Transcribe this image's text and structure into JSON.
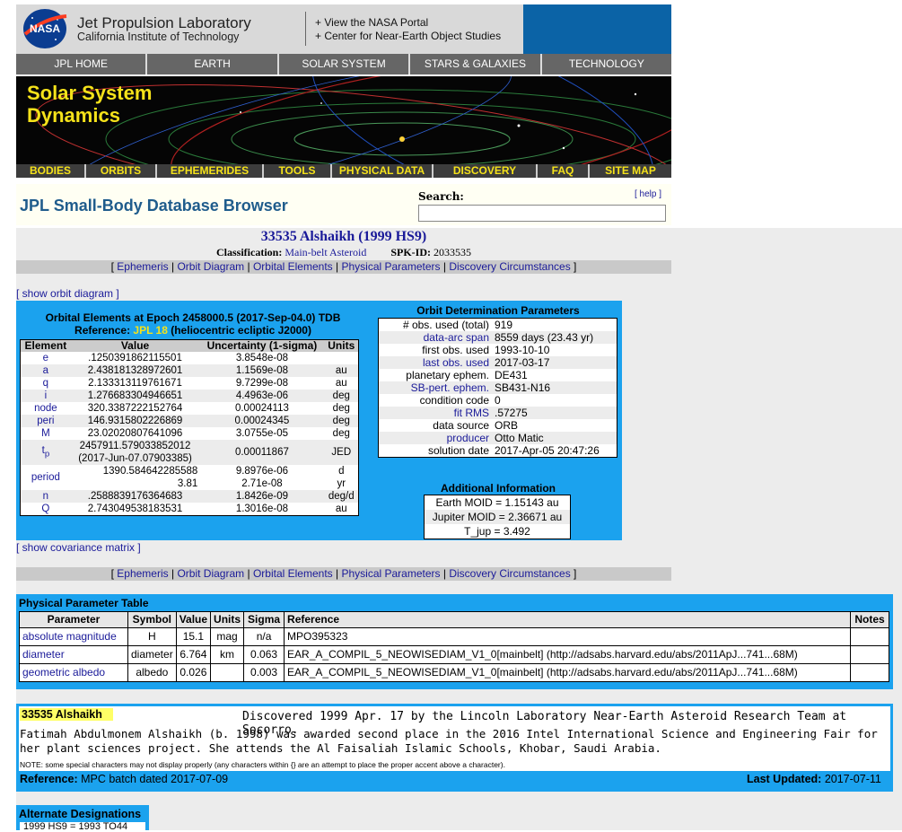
{
  "header": {
    "logo_text": "NASA",
    "title": "Jet Propulsion Laboratory",
    "subtitle": "California Institute of Technology",
    "portal_link": "+ View the NASA Portal",
    "neo_link": "+ Center for Near-Earth Object Studies"
  },
  "topnav": [
    "JPL HOME",
    "EARTH",
    "SOLAR SYSTEM",
    "STARS & GALAXIES",
    "TECHNOLOGY"
  ],
  "banner": {
    "line1": "Solar System",
    "line2": "Dynamics"
  },
  "subnav": [
    "BODIES",
    "ORBITS",
    "EPHEMERIDES",
    "TOOLS",
    "PHYSICAL DATA",
    "DISCOVERY",
    "FAQ",
    "SITE MAP"
  ],
  "page_title": "JPL Small-Body Database Browser",
  "search": {
    "label": "Search:",
    "help": "[ help ]",
    "value": ""
  },
  "object": {
    "title": "33535 Alshaikh (1999 HS9)",
    "class_label": "Classification:",
    "class_value": "Main-belt Asteroid",
    "spk_label": "SPK-ID:",
    "spk_value": "2033535"
  },
  "linkbar": [
    "Ephemeris",
    "Orbit Diagram",
    "Orbital Elements",
    "Physical Parameters",
    "Discovery Circumstances"
  ],
  "show_orbit": "[ show orbit diagram ]",
  "show_cov": "[ show covariance matrix ]",
  "orbital_elements": {
    "title": "Orbital Elements at Epoch 2458000.5 (2017-Sep-04.0) TDB",
    "ref_prefix": "Reference:",
    "ref_value": "JPL 18",
    "ref_suffix": "(heliocentric ecliptic J2000)",
    "headers": [
      "Element",
      "Value",
      "Uncertainty (1-sigma)",
      "Units"
    ],
    "rows": [
      {
        "el": "e",
        "val": ".1250391862115501",
        "unc": "3.8548e-08",
        "units": ""
      },
      {
        "el": "a",
        "val": "2.438181328972601",
        "unc": "1.1569e-08",
        "units": "au"
      },
      {
        "el": "q",
        "val": "2.133313119761671",
        "unc": "9.7299e-08",
        "units": "au"
      },
      {
        "el": "i",
        "val": "1.276683304946651",
        "unc": "4.4963e-06",
        "units": "deg"
      },
      {
        "el": "node",
        "val": "320.3387222152764",
        "unc": "0.00024113",
        "units": "deg"
      },
      {
        "el": "peri",
        "val": "146.9315802226869",
        "unc": "0.00024345",
        "units": "deg"
      },
      {
        "el": "M",
        "val": "23.02020807641096",
        "unc": "3.0755e-05",
        "units": "deg"
      }
    ],
    "tp": {
      "el": "t",
      "sub": "p",
      "val1": "2457911.579033852012",
      "val2": "(2017-Jun-07.07903385)",
      "unc": "0.00011867",
      "units": "JED"
    },
    "period": {
      "el": "period",
      "val1": "1390.584642285588",
      "val2": "3.81",
      "unc1": "9.8976e-06",
      "unc2": "2.71e-08",
      "u1": "d",
      "u2": "yr"
    },
    "rows2": [
      {
        "el": "n",
        "val": ".2588839176364683",
        "unc": "1.8426e-09",
        "units": "deg/d"
      },
      {
        "el": "Q",
        "val": "2.743049538183531",
        "unc": "1.3016e-08",
        "units": "au"
      }
    ]
  },
  "orbit_determination": {
    "title": "Orbit Determination Parameters",
    "rows": [
      {
        "k": "# obs. used (total)",
        "v": "919",
        "link": false
      },
      {
        "k": "data-arc span",
        "v": "8559 days (23.43 yr)",
        "link": true
      },
      {
        "k": "first obs. used",
        "v": "1993-10-10",
        "link": false
      },
      {
        "k": "last obs. used",
        "v": "2017-03-17",
        "link": true
      },
      {
        "k": "planetary ephem.",
        "v": "DE431",
        "link": false
      },
      {
        "k": "SB-pert. ephem.",
        "v": "SB431-N16",
        "link": true
      },
      {
        "k": "condition code",
        "v": "0",
        "link": false
      },
      {
        "k": "fit RMS",
        "v": ".57275",
        "link": true
      },
      {
        "k": "data source",
        "v": "ORB",
        "link": false
      },
      {
        "k": "producer",
        "v": "Otto Matic",
        "link": true
      },
      {
        "k": "solution date",
        "v": "2017-Apr-05 20:47:26",
        "link": false
      }
    ]
  },
  "additional_info": {
    "title": "Additional Information",
    "rows": [
      "Earth MOID = 1.15143 au",
      "Jupiter MOID = 2.36671 au",
      "T_jup = 3.492"
    ]
  },
  "physical": {
    "title": "Physical Parameter Table",
    "headers": [
      "Parameter",
      "Symbol",
      "Value",
      "Units",
      "Sigma",
      "Reference",
      "Notes"
    ],
    "rows": [
      [
        "absolute magnitude",
        "H",
        "15.1",
        "mag",
        "n/a",
        "MPO395323",
        ""
      ],
      [
        "diameter",
        "diameter",
        "6.764",
        "km",
        "0.063",
        "EAR_A_COMPIL_5_NEOWISEDIAM_V1_0[mainbelt] (http://adsabs.harvard.edu/abs/2011ApJ...741...68M)",
        ""
      ],
      [
        "geometric albedo",
        "albedo",
        "0.026",
        "",
        "0.003",
        "EAR_A_COMPIL_5_NEOWISEDIAM_V1_0[mainbelt] (http://adsabs.harvard.edu/abs/2011ApJ...741...68M)",
        ""
      ]
    ]
  },
  "discovery": {
    "name": "33535 Alshaikh",
    "line": "Discovered 1999 Apr. 17 by the Lincoln Laboratory Near-Earth Asteroid Research Team at Socorro.",
    "text": "Fatimah Abdulmonem Alshaikh (b. 1998) was awarded second place in the 2016 Intel International Science and Engineering Fair for her plant sciences project. She attends the Al Faisaliah Islamic Schools, Khobar, Saudi Arabia.",
    "note": "NOTE: some special characters may not display properly (any characters within {} are an attempt to place the proper accent above a character).",
    "ref_label": "Reference:",
    "ref_value": "MPC batch dated 2017-07-09",
    "updated_label": "Last Updated:",
    "updated_value": "2017-07-11"
  },
  "alternate": {
    "title": "Alternate Designations",
    "text": "1999 HS9 = 1993 TO44"
  },
  "colors": {
    "panel_blue": "#1ba2ee",
    "banner_yellow": "#f5e21a",
    "link": "#1a1a99"
  }
}
